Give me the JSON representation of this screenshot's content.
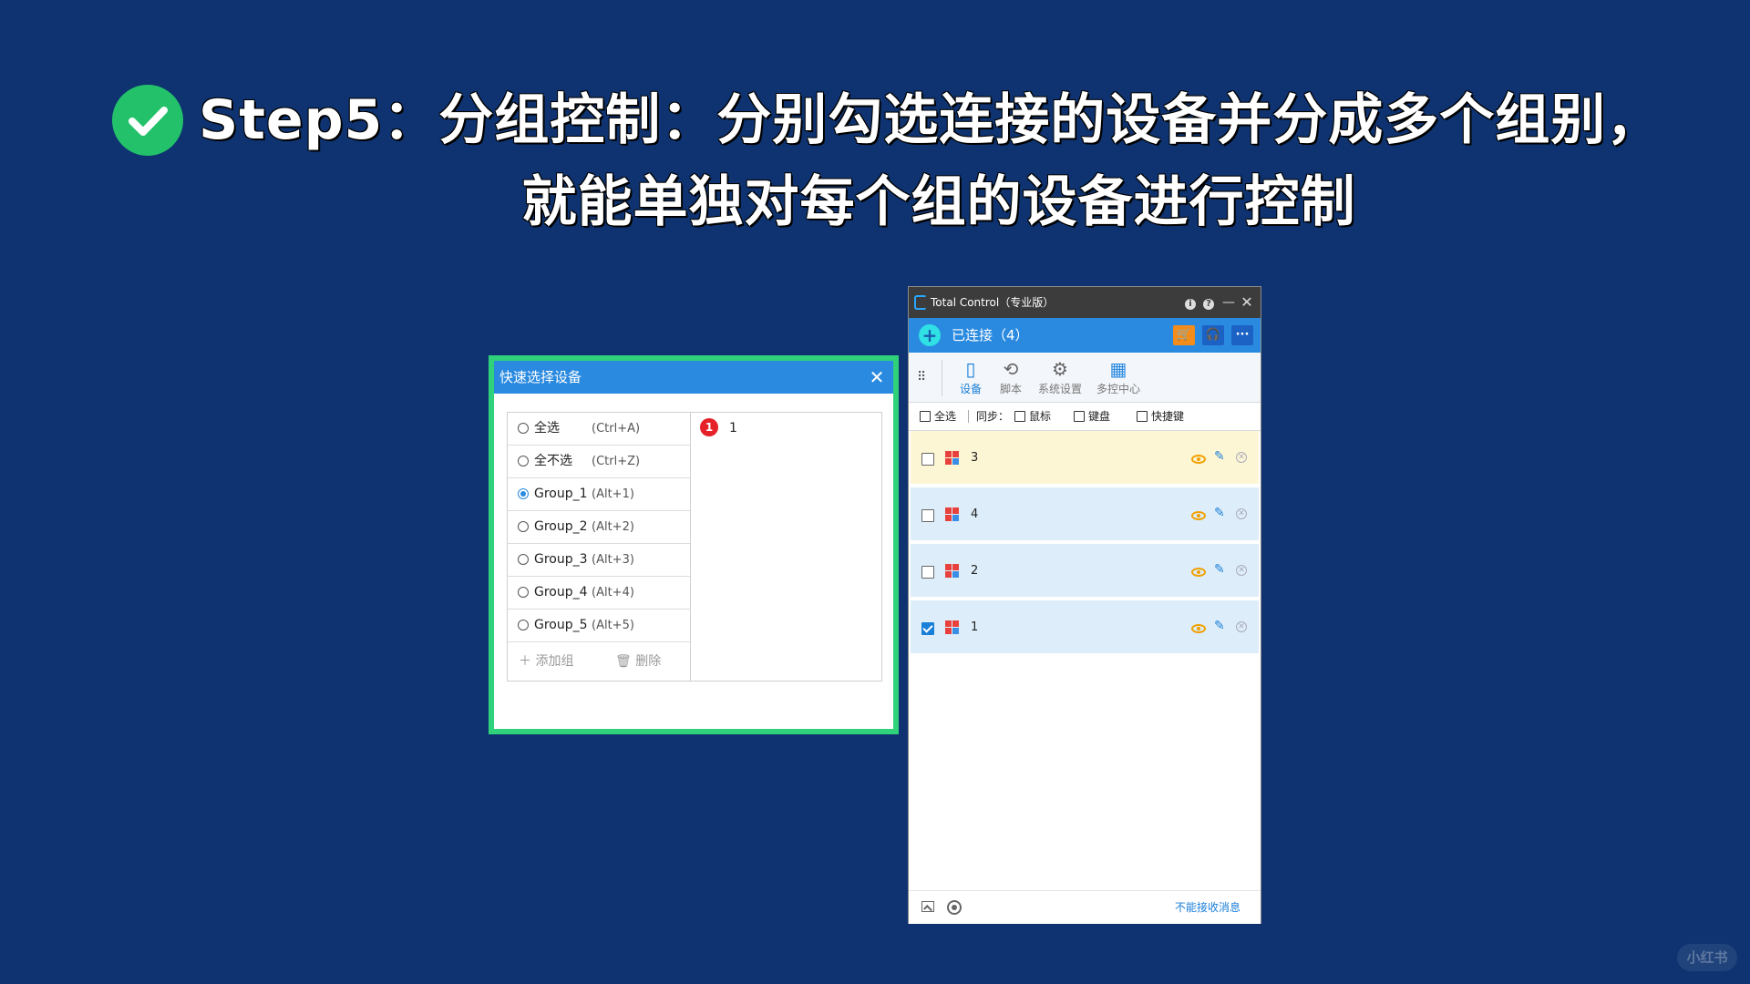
{
  "headline": {
    "line1": "Step5：分组控制：分别勾选连接的设备并分成多个组别，",
    "line2": "就能单独对每个组的设备进行控制",
    "badge_color": "#24c16b"
  },
  "dialog": {
    "title": "快速选择设备",
    "options": [
      {
        "label": "全选",
        "shortcut": "(Ctrl+A)",
        "selected": false
      },
      {
        "label": "全不选",
        "shortcut": "(Ctrl+Z)",
        "selected": false
      },
      {
        "label": "Group_1",
        "shortcut": "(Alt+1)",
        "selected": true
      },
      {
        "label": "Group_2",
        "shortcut": "(Alt+2)",
        "selected": false
      },
      {
        "label": "Group_3",
        "shortcut": "(Alt+3)",
        "selected": false
      },
      {
        "label": "Group_4",
        "shortcut": "(Alt+4)",
        "selected": false
      },
      {
        "label": "Group_5",
        "shortcut": "(Alt+5)",
        "selected": false
      }
    ],
    "add_group": "添加组",
    "delete": "删除",
    "devices": [
      {
        "badge": "1",
        "name": "1"
      }
    ],
    "border_color": "#2fd27a"
  },
  "window": {
    "title": "Total Control（专业版）",
    "connected": "已连接（4）",
    "nav": {
      "device": "设备",
      "script": "脚本",
      "system": "系统设置",
      "multi": "多控中心"
    },
    "sync": {
      "select_all": "全选",
      "sync_label": "同步：",
      "mouse": "鼠标",
      "keyboard": "键盘",
      "hotkey": "快捷键"
    },
    "devices": [
      {
        "name": "3",
        "checked": false,
        "highlight": true
      },
      {
        "name": "4",
        "checked": false,
        "highlight": false
      },
      {
        "name": "2",
        "checked": false,
        "highlight": false
      },
      {
        "name": "1",
        "checked": true,
        "highlight": false
      }
    ],
    "status_message": "不能接收消息",
    "accent_color": "#2a8ae0"
  },
  "watermark": "小红书"
}
